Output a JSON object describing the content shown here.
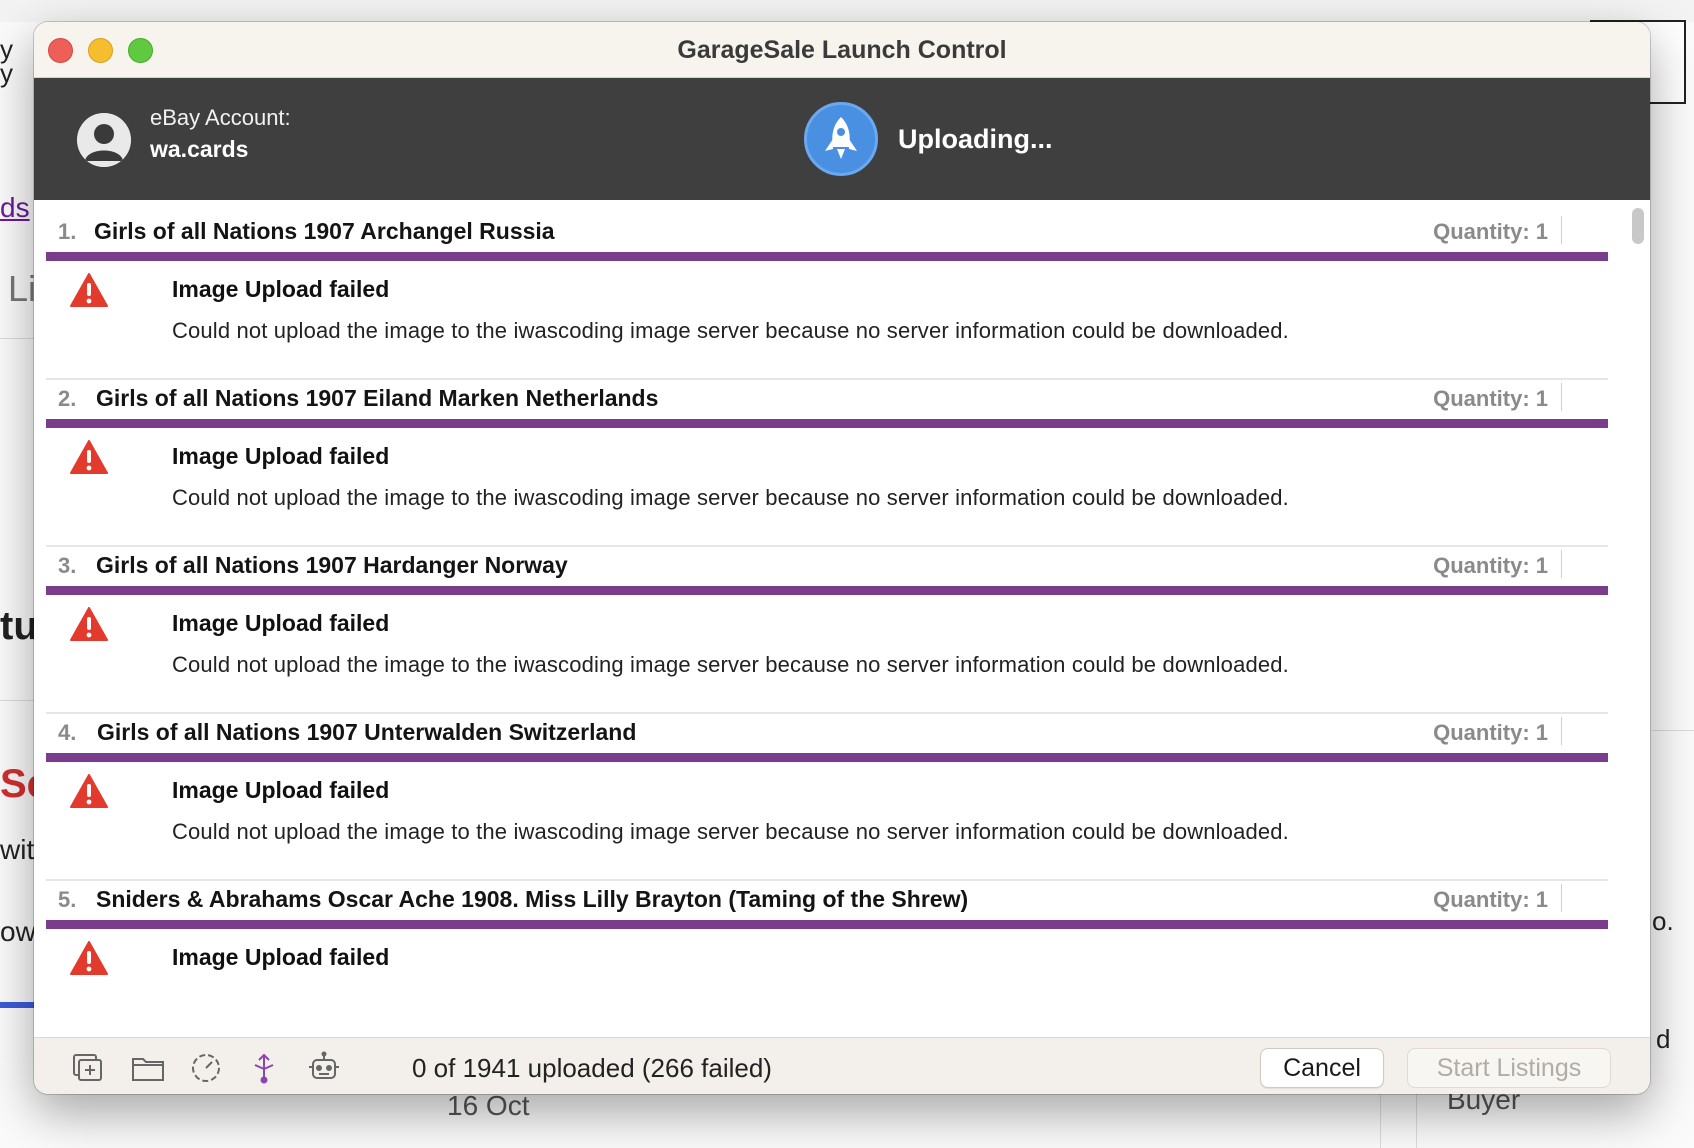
{
  "background": {
    "fragments": [
      "y",
      "y",
      "ds",
      "Li",
      "tu",
      "Sc",
      "wit",
      "ow",
      "o.",
      "d",
      "16 Oct",
      "Buyer"
    ]
  },
  "window": {
    "title": "GarageSale Launch Control"
  },
  "header": {
    "account_label": "eBay Account:",
    "account_name": "wa.cards",
    "status": "Uploading..."
  },
  "items": [
    {
      "num": "1.",
      "title": "Girls of all Nations 1907 Archangel Russia",
      "quantity": "Quantity: 1",
      "error_title": "Image Upload failed",
      "error_message": "Could not upload the image to the iwascoding image server because no server information could be downloaded."
    },
    {
      "num": "2.",
      "title": "Girls of all Nations 1907 Eiland Marken Netherlands",
      "quantity": "Quantity: 1",
      "error_title": "Image Upload failed",
      "error_message": "Could not upload the image to the iwascoding image server because no server information could be downloaded."
    },
    {
      "num": "3.",
      "title": "Girls of all Nations 1907 Hardanger Norway",
      "quantity": "Quantity: 1",
      "error_title": "Image Upload failed",
      "error_message": "Could not upload the image to the iwascoding image server because no server information could be downloaded."
    },
    {
      "num": "4.",
      "title": "Girls of all Nations 1907 Unterwalden Switzerland",
      "quantity": "Quantity: 1",
      "error_title": "Image Upload failed",
      "error_message": "Could not upload the image to the iwascoding image server because no server information could be downloaded."
    },
    {
      "num": "5.",
      "title": "Sniders & Abrahams Oscar Ache 1908. Miss Lilly Brayton (Taming of the Shrew)",
      "quantity": "Quantity: 1",
      "error_title": "Image Upload failed",
      "error_message": ""
    }
  ],
  "footer": {
    "progress_text": "0 of 1941 uploaded (266 failed)",
    "cancel_label": "Cancel",
    "start_label": "Start Listings",
    "icons": [
      "add-listing-icon",
      "folder-icon",
      "clock-icon",
      "share-icon",
      "robot-icon"
    ]
  },
  "colors": {
    "progress_bar": "#7a3d8c",
    "header_bg": "#3f3f3f",
    "rocket_bg": "#4a90e2",
    "warning": "#e23b2e"
  }
}
